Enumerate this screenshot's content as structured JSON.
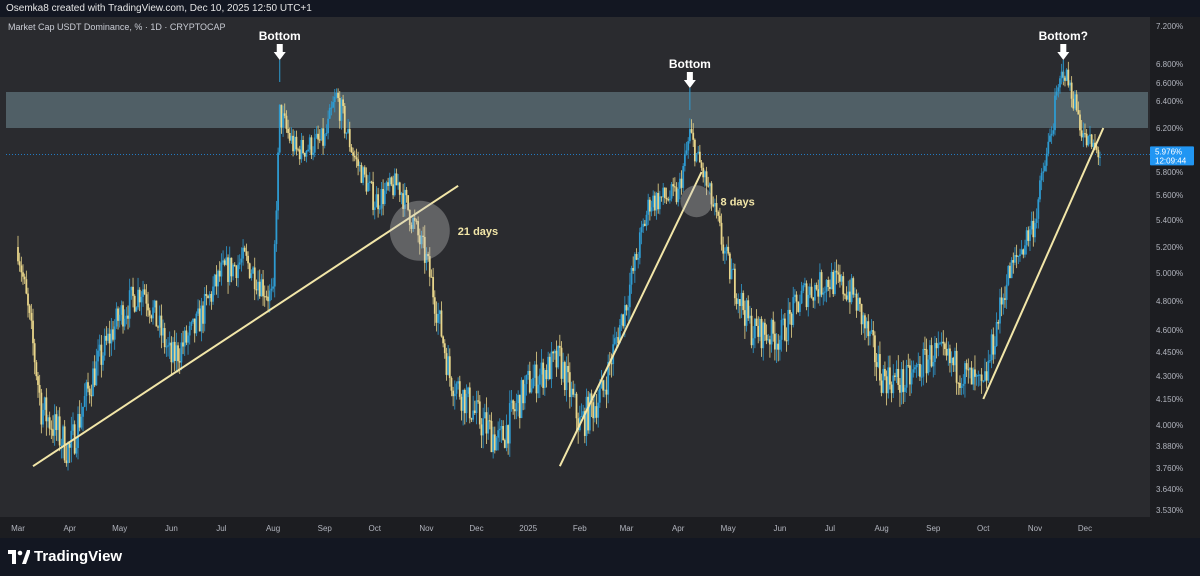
{
  "header": {
    "credit": "Osemka8 created with TradingView.com, Dec 10, 2025 12:50 UTC+1",
    "symbol": "Market Cap USDT Dominance, % · 1D · CRYPTOCAP"
  },
  "footer": {
    "brand": "TradingView"
  },
  "colors": {
    "background": "#2a2b2f",
    "bull": "#2e9bd1",
    "bear": "#e8d58a",
    "trendline": "#f2e6a8",
    "zone": "#6f8a94",
    "price_badge": "#2196f3"
  },
  "chart_data": {
    "type": "line",
    "title": "Market Cap USDT Dominance, % · 1D · CRYPTOCAP",
    "y_unit": "%",
    "ylim": [
      3.5,
      7.25
    ],
    "y_ticks": [
      "7.200%",
      "6.800%",
      "6.600%",
      "6.400%",
      "6.200%",
      "6.000%",
      "5.800%",
      "5.600%",
      "5.400%",
      "5.200%",
      "5.000%",
      "4.800%",
      "4.600%",
      "4.450%",
      "4.300%",
      "4.150%",
      "4.000%",
      "3.880%",
      "3.760%",
      "3.640%",
      "3.530%"
    ],
    "x_ticks": [
      "Mar",
      "Apr",
      "May",
      "Jun",
      "Jul",
      "Aug",
      "Sep",
      "Oct",
      "Nov",
      "Dec",
      "2025",
      "Feb",
      "Mar",
      "Apr",
      "May",
      "Jun",
      "Jul",
      "Aug",
      "Sep",
      "Oct",
      "Nov",
      "Dec"
    ],
    "series": [
      {
        "type": "candlestick",
        "x": [
          "2024-03-01",
          "2024-03-15",
          "2024-04-01",
          "2024-04-15",
          "2024-05-01",
          "2024-05-15",
          "2024-06-01",
          "2024-06-15",
          "2024-07-01",
          "2024-07-15",
          "2024-08-01",
          "2024-08-05",
          "2024-08-15",
          "2024-09-01",
          "2024-09-08",
          "2024-09-20",
          "2024-10-01",
          "2024-10-15",
          "2024-11-01",
          "2024-11-15",
          "2024-12-01",
          "2024-12-15",
          "2025-01-01",
          "2025-01-20",
          "2025-02-01",
          "2025-02-15",
          "2025-03-01",
          "2025-03-15",
          "2025-04-01",
          "2025-04-08",
          "2025-04-20",
          "2025-05-01",
          "2025-05-15",
          "2025-06-01",
          "2025-06-15",
          "2025-07-01",
          "2025-07-15",
          "2025-08-01",
          "2025-08-15",
          "2025-09-01",
          "2025-09-15",
          "2025-10-01",
          "2025-10-15",
          "2025-11-01",
          "2025-11-18",
          "2025-12-01",
          "2025-12-10"
        ],
        "y": [
          5.2,
          4.1,
          3.85,
          4.3,
          4.7,
          4.9,
          4.4,
          4.6,
          5.0,
          5.1,
          4.8,
          6.3,
          6.0,
          6.1,
          6.45,
          5.9,
          5.55,
          5.7,
          5.1,
          4.3,
          4.05,
          3.9,
          4.25,
          4.4,
          4.0,
          4.2,
          4.8,
          5.55,
          5.6,
          6.15,
          5.6,
          5.05,
          4.6,
          4.55,
          4.85,
          4.95,
          4.85,
          4.3,
          4.25,
          4.45,
          4.35,
          4.2,
          4.95,
          5.4,
          6.75,
          6.1,
          5.98
        ]
      }
    ],
    "annotations": [
      {
        "text": "Bottom",
        "x": "2024-08-05",
        "y": 6.8
      },
      {
        "text": "Bottom",
        "x": "2025-04-08",
        "y": 6.5
      },
      {
        "text": "Bottom?",
        "x": "2025-11-18",
        "y": 6.8
      },
      {
        "text": "21 days",
        "x": "2024-10-28",
        "y": 5.35
      },
      {
        "text": "8 days",
        "x": "2025-04-14",
        "y": 5.55
      }
    ],
    "resistance_zone": [
      6.2,
      6.5
    ],
    "last_price": {
      "value": "5.976%",
      "countdown": "12:09:44"
    },
    "trendlines": [
      {
        "from": [
          "2024-03-10",
          3.77
        ],
        "to": [
          "2024-11-20",
          5.68
        ]
      },
      {
        "from": [
          "2025-01-20",
          3.77
        ],
        "to": [
          "2025-04-15",
          5.8
        ]
      },
      {
        "from": [
          "2025-10-01",
          4.15
        ],
        "to": [
          "2025-12-12",
          6.2
        ]
      }
    ],
    "grid": false
  }
}
